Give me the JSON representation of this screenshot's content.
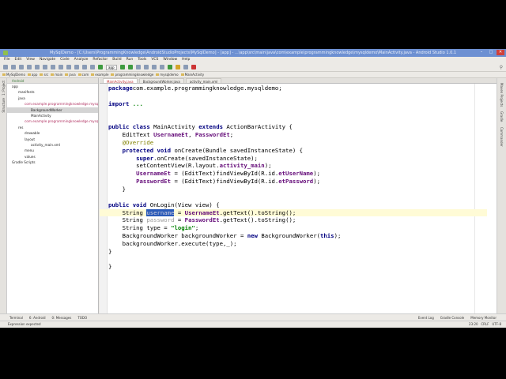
{
  "window": {
    "title": "MySqlDemo - [C:\\Users\\ProgrammingKnowledge\\AndroidStudioProjects\\MySqlDemo] - [app] - ...\\app\\src\\main\\java\\com\\example\\programmingknowledge\\mysqldemo\\MainActivity.java - Android Studio 1.0.1"
  },
  "menu": [
    "File",
    "Edit",
    "View",
    "Navigate",
    "Code",
    "Analyze",
    "Refactor",
    "Build",
    "Run",
    "Tools",
    "VCS",
    "Window",
    "Help"
  ],
  "toolbar": {
    "run_config": "app"
  },
  "breadcrumbs": [
    "MySqlDemo",
    "app",
    "src",
    "main",
    "java",
    "com",
    "example",
    "programmingknowledge",
    "mysqldemo",
    "MainActivity"
  ],
  "project_panel": {
    "view_selector": "Android",
    "strip_labels": [
      "1: Project",
      "Structure"
    ],
    "tree": [
      {
        "label": "app",
        "depth": 0
      },
      {
        "label": "manifests",
        "depth": 1
      },
      {
        "label": "java",
        "depth": 1
      },
      {
        "label": "com.example.programmingknowledge.mysqldemo",
        "depth": 2,
        "pkg": true
      },
      {
        "label": "BackgroundWorker",
        "depth": 3,
        "selected": true
      },
      {
        "label": "MainActivity",
        "depth": 3
      },
      {
        "label": "com.example.programmingknowledge.mysqldemo (androidTest)",
        "depth": 2,
        "pkg": true
      },
      {
        "label": "res",
        "depth": 1
      },
      {
        "label": "drawable",
        "depth": 2
      },
      {
        "label": "layout",
        "depth": 2
      },
      {
        "label": "activity_main.xml",
        "depth": 3
      },
      {
        "label": "menu",
        "depth": 2
      },
      {
        "label": "values",
        "depth": 2
      },
      {
        "label": "Gradle Scripts",
        "depth": 0
      }
    ]
  },
  "editor_tabs": [
    {
      "label": "MainActivity.java",
      "active": true
    },
    {
      "label": "BackgroundWorker.java"
    },
    {
      "label": "activity_main.xml"
    }
  ],
  "code": [
    [
      [
        "kw",
        "package"
      ],
      [
        "",
        "com.example.programmingknowledge.mysqldemo;"
      ]
    ],
    [],
    [
      [
        "kw",
        "import"
      ],
      [
        "st",
        " ..."
      ]
    ],
    [],
    [],
    [
      [
        "kw",
        "public class"
      ],
      [
        "",
        " MainActivity "
      ],
      [
        "kw",
        "extends"
      ],
      [
        "",
        " ActionBarActivity {"
      ]
    ],
    [
      [
        "",
        "    EditText "
      ],
      [
        "fd",
        "UsernameEt"
      ],
      [
        "",
        ", "
      ],
      [
        "fd",
        "PasswordEt"
      ],
      [
        "",
        ";"
      ]
    ],
    [
      [
        "an",
        "    @Override"
      ]
    ],
    [
      [
        "kw",
        "    protected void"
      ],
      [
        "",
        " onCreate(Bundle savedInstanceState) {"
      ]
    ],
    [
      [
        "kw",
        "        super"
      ],
      [
        "",
        ".onCreate(savedInstanceState);"
      ]
    ],
    [
      [
        "",
        "        setContentView(R.layout."
      ],
      [
        "fd",
        "activity_main"
      ],
      [
        "",
        ");"
      ]
    ],
    [
      [
        "fd",
        "        UsernameEt"
      ],
      [
        "",
        " = (EditText)findViewById(R.id."
      ],
      [
        "fd",
        "etUserName"
      ],
      [
        "",
        ");"
      ]
    ],
    [
      [
        "fd",
        "        PasswordEt"
      ],
      [
        "",
        " = (EditText)findViewById(R.id."
      ],
      [
        "fd",
        "etPassword"
      ],
      [
        "",
        ");"
      ]
    ],
    [
      [
        "",
        "    }"
      ]
    ],
    [],
    [
      [
        "kw",
        "public void"
      ],
      [
        "",
        " OnLogin(View view) {"
      ]
    ],
    [
      [
        "",
        "    String "
      ],
      [
        "sh",
        "username"
      ],
      [
        "",
        " = "
      ],
      [
        "fd",
        "UsernameEt"
      ],
      [
        "",
        ".getText().toString();"
      ]
    ],
    [
      [
        "",
        "    String "
      ],
      [
        "un",
        "password"
      ],
      [
        "",
        " = "
      ],
      [
        "fd",
        "PasswordEt"
      ],
      [
        "",
        ".getText().toString();"
      ]
    ],
    [
      [
        "",
        "    String type = "
      ],
      [
        "st",
        "\"login\""
      ],
      [
        "",
        ";"
      ]
    ],
    [
      [
        "",
        "    BackgroundWorker backgroundWorker = "
      ],
      [
        "kw",
        "new"
      ],
      [
        "",
        " BackgroundWorker("
      ],
      [
        "kw",
        "this"
      ],
      [
        "",
        ");"
      ]
    ],
    [
      [
        "",
        "    backgroundWorker.execute(type,_);"
      ]
    ],
    [
      [
        "",
        "}"
      ]
    ],
    [],
    [
      [
        "",
        "}"
      ]
    ]
  ],
  "highlighted_line": 16,
  "right_strip": [
    "Maven Projects",
    "Gradle",
    "Commander"
  ],
  "bottom_tabs": [
    "Terminal",
    "6: Android",
    "0: Messages",
    "TODO"
  ],
  "bottom_tabs_right": [
    "Event Log",
    "Gradle Console",
    "Memory Monitor"
  ],
  "status": {
    "message": "Expression expected",
    "position": "23:20",
    "line_sep": "CRLF",
    "encoding": "UTF-8"
  }
}
